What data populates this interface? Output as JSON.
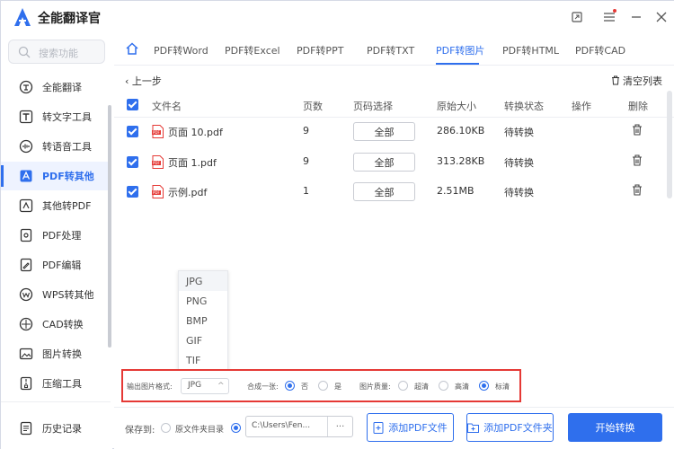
{
  "app": {
    "title": "全能翻译官"
  },
  "search": {
    "placeholder": "搜索功能"
  },
  "sidebar": {
    "items": [
      {
        "label": "全能翻译",
        "icon": "translate-icon"
      },
      {
        "label": "转文字工具",
        "icon": "text-convert-icon"
      },
      {
        "label": "转语音工具",
        "icon": "voice-icon"
      },
      {
        "label": "PDF转其他",
        "icon": "pdf-convert-icon",
        "active": true
      },
      {
        "label": "其他转PDF",
        "icon": "to-pdf-icon"
      },
      {
        "label": "PDF处理",
        "icon": "pdf-process-icon"
      },
      {
        "label": "PDF编辑",
        "icon": "pdf-edit-icon"
      },
      {
        "label": "WPS转其他",
        "icon": "wps-icon"
      },
      {
        "label": "CAD转换",
        "icon": "cad-icon"
      },
      {
        "label": "图片转换",
        "icon": "image-convert-icon"
      },
      {
        "label": "压缩工具",
        "icon": "compress-icon"
      }
    ],
    "history_label": "历史记录"
  },
  "tabs": [
    "PDF转Word",
    "PDF转Excel",
    "PDF转PPT",
    "PDF转TXT",
    "PDF转图片",
    "PDF转HTML",
    "PDF转CAD"
  ],
  "active_tab": "PDF转图片",
  "toolbar": {
    "back_label": "上一步",
    "clear_label": "清空列表"
  },
  "table": {
    "columns": [
      "文件名",
      "页数",
      "页码选择",
      "原始大小",
      "转换状态",
      "操作",
      "删除"
    ],
    "rows": [
      {
        "name": "页面 10.pdf",
        "pages": "9",
        "range": "全部",
        "size": "286.10KB",
        "status": "待转换"
      },
      {
        "name": "页面 1.pdf",
        "pages": "9",
        "range": "全部",
        "size": "313.28KB",
        "status": "待转换"
      },
      {
        "name": "示例.pdf",
        "pages": "1",
        "range": "全部",
        "size": "2.51MB",
        "status": "待转换"
      }
    ]
  },
  "format_dropdown": {
    "options": [
      "JPG",
      "PNG",
      "BMP",
      "GIF",
      "TIF"
    ],
    "highlighted": "JPG"
  },
  "options": {
    "format_label": "输出图片格式:",
    "format_value": "JPG",
    "merge_label": "合成一张:",
    "merge_no": "否",
    "merge_yes": "是",
    "merge_selected": "否",
    "quality_label": "图片质量:",
    "quality_options": [
      "超清",
      "高清",
      "标清"
    ],
    "quality_selected": "标清"
  },
  "bottom": {
    "save_label": "保存到:",
    "source_dir_label": "原文件夹目录",
    "path_value": "C:\\Users\\Fen...",
    "more_label": "···",
    "add_file_label": "添加PDF文件",
    "add_folder_label": "添加PDF文件夹",
    "start_label": "开始转换"
  },
  "colors": {
    "accent": "#2f6fed",
    "highlight_border": "#e53935"
  }
}
